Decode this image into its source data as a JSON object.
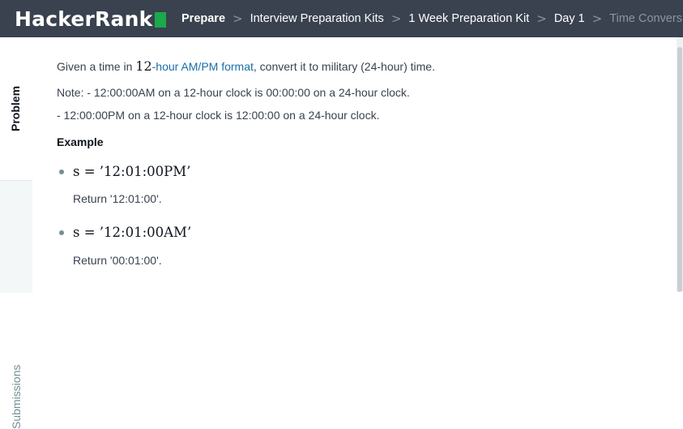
{
  "header": {
    "logo_text": "HackerRank",
    "breadcrumbs": [
      {
        "label": "Prepare"
      },
      {
        "label": "Interview Preparation Kits"
      },
      {
        "label": "1 Week Preparation Kit"
      },
      {
        "label": "Day 1"
      },
      {
        "label": "Time Conversion"
      }
    ],
    "separator": ">"
  },
  "sidebar": {
    "tabs": [
      {
        "label": "Problem"
      },
      {
        "label": "Submissions"
      }
    ]
  },
  "problem": {
    "intro_before": "Given a time in ",
    "intro_math": "12",
    "intro_link": "-hour AM/PM format",
    "intro_after": ", convert it to military (24-hour) time.",
    "note_line1": "Note: - 12:00:00AM on a 12-hour clock is 00:00:00 on a 24-hour clock.",
    "note_line2": "- 12:00:00PM on a 12-hour clock is 12:00:00 on a 24-hour clock.",
    "example_heading": "Example",
    "examples": [
      {
        "input": "s = ’12:01:00PM’",
        "output": "Return '12:01:00'."
      },
      {
        "input": "s = ’12:01:00AM’",
        "output": "Return '00:01:00'."
      }
    ]
  },
  "colors": {
    "topbar": "#39424e",
    "brand_green": "#1ba94c",
    "link": "#1a6ea8",
    "body_text": "#39424e"
  }
}
